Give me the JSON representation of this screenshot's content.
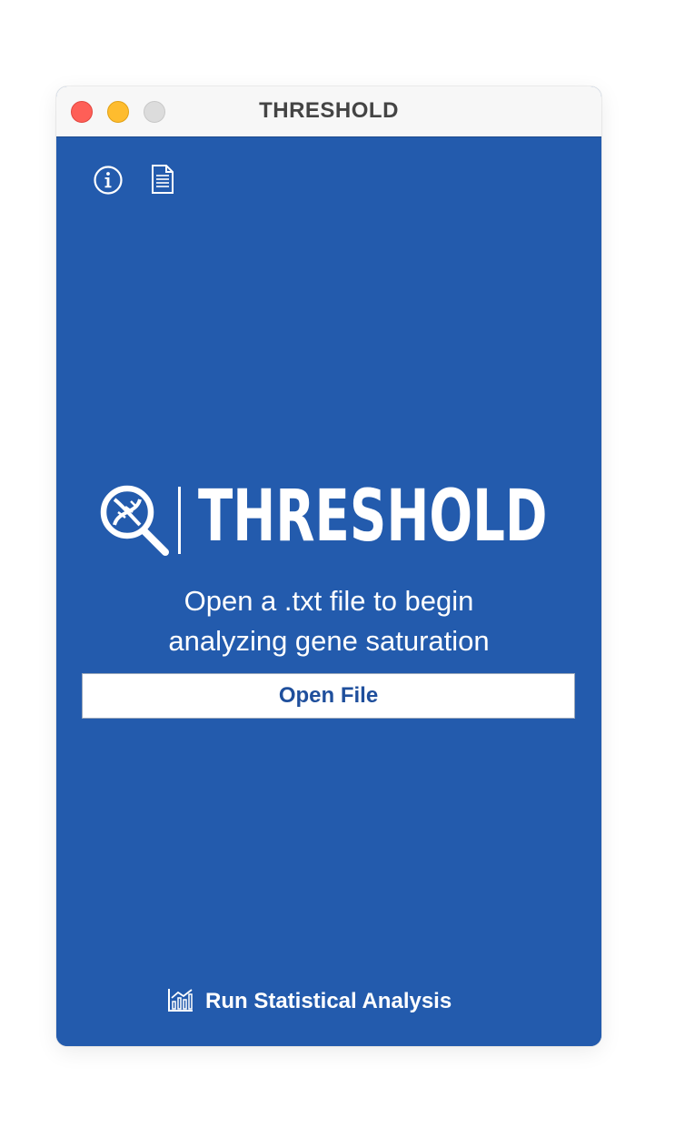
{
  "window": {
    "title": "THRESHOLD"
  },
  "toolbar": {
    "icons": [
      "info-icon",
      "document-icon"
    ]
  },
  "logo": {
    "text": "THRESHOLD",
    "icon": "dna-magnifier-icon"
  },
  "main": {
    "prompt_line1": "Open a .txt file to begin",
    "prompt_line2": "analyzing gene saturation",
    "open_button_label": "Open File"
  },
  "footer": {
    "run_label": "Run Statistical Analysis",
    "run_icon": "chart-icon"
  },
  "colors": {
    "background": "#235bad",
    "button_text": "#1f4f9c",
    "titlebar": "#f7f7f7",
    "close": "#fe5f57",
    "minimize": "#febc2e",
    "zoom": "#dcdcdc"
  }
}
